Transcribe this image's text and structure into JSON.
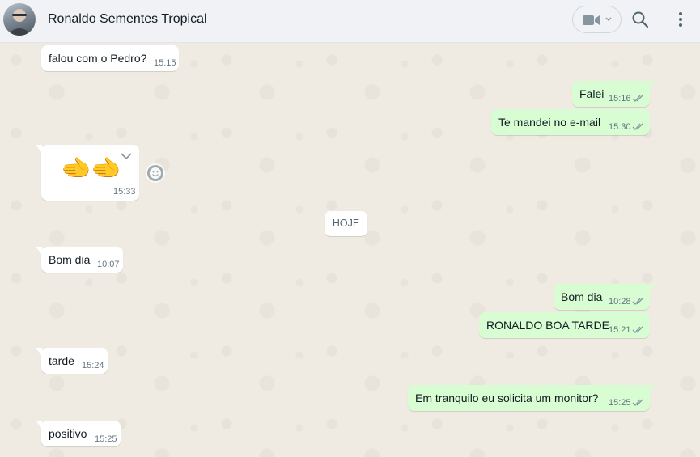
{
  "header": {
    "contact_name": "Ronaldo Sementes Tropical",
    "avatar_icon": "avatar",
    "video_icon": "video-camera-icon",
    "search_icon": "search-icon",
    "menu_icon": "kebab-menu-icon"
  },
  "colors": {
    "incoming_bubble": "#ffffff",
    "outgoing_bubble": "#d9fdd3",
    "chat_background": "#efeae2",
    "read_ticks": "#8696a0"
  },
  "messages": [
    {
      "dir": "in",
      "text": "falou com o Pedro?",
      "time": "15:15"
    },
    {
      "dir": "out",
      "text": "Falei",
      "time": "15:16",
      "status": "read"
    },
    {
      "dir": "out",
      "text": "Te mandei no e-mail",
      "time": "15:30",
      "status": "read"
    },
    {
      "dir": "in",
      "text": "🫲🫲",
      "time": "15:33",
      "type": "emoji"
    },
    {
      "dir": "in",
      "text": "Bom dia",
      "time": "10:07"
    },
    {
      "dir": "out",
      "text": "Bom dia",
      "time": "10:28",
      "status": "read"
    },
    {
      "dir": "out",
      "text": "RONALDO BOA TARDE",
      "time": "15:21",
      "status": "read"
    },
    {
      "dir": "in",
      "text": "tarde",
      "time": "15:24"
    },
    {
      "dir": "out",
      "text": "Em tranquilo eu solicita um monitor?",
      "time": "15:25",
      "status": "read"
    },
    {
      "dir": "in",
      "text": "positivo",
      "time": "15:25"
    }
  ],
  "day_separator": "HOJE"
}
